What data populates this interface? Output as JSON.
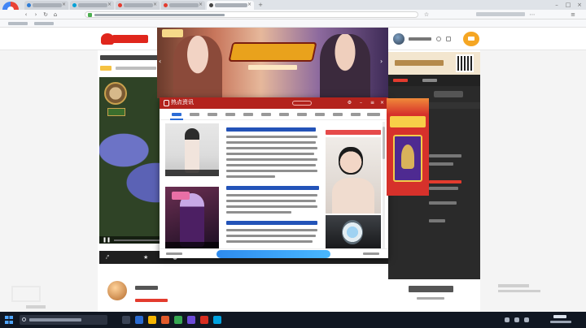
{
  "browser": {
    "tabs": [
      {
        "title": "",
        "fav_color": "#2d7cd6",
        "active": false
      },
      {
        "title": "",
        "fav_color": "#00a1d6",
        "active": false
      },
      {
        "title": "",
        "fav_color": "#e33b2e",
        "active": false
      },
      {
        "title": "",
        "fav_color": "#e33b2e",
        "active": true
      },
      {
        "title": "",
        "fav_color": "#444444",
        "active": false
      }
    ],
    "url": "",
    "accent": "#4caf50"
  },
  "site": {
    "menu_items": [
      "",
      "",
      "",
      ""
    ],
    "search_placeholder": "",
    "brand_color": "#e0261c",
    "accent": "#f37c1e"
  },
  "popup": {
    "title": "热点资讯",
    "tabs": [
      "",
      "",
      "",
      "",
      "",
      "",
      "",
      "",
      "",
      "",
      "",
      ""
    ],
    "header_color": "#b3231d",
    "link_color": "#2353b8"
  },
  "taskbar": {
    "search_placeholder": "",
    "time": "",
    "date": ""
  },
  "icons": [
    "search-icon",
    "refresh-icon",
    "back-icon",
    "forward-icon",
    "home-icon",
    "close-icon",
    "settings-icon",
    "minimize-icon",
    "windows-start-icon",
    "upload-icon",
    "play-icon",
    "share-icon"
  ]
}
